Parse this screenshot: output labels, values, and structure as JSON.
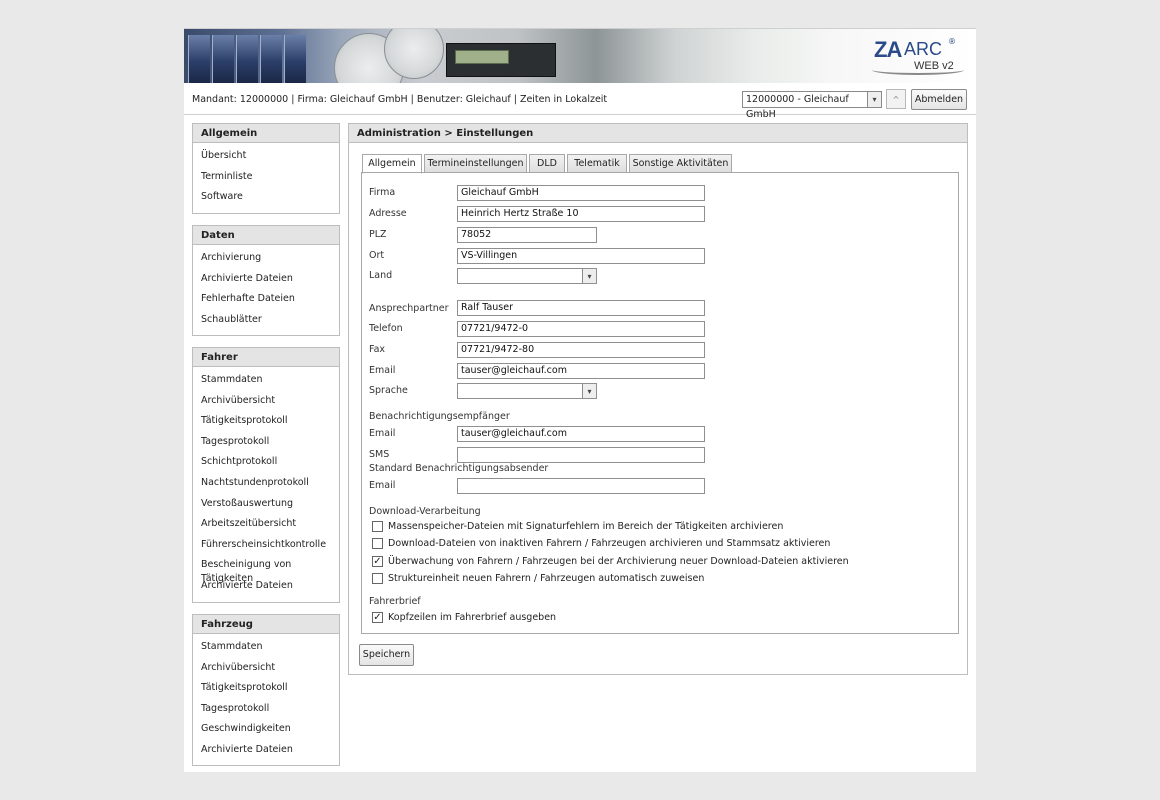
{
  "banner": {
    "logo_za": "ZA",
    "logo_arc": "ARC",
    "logo_reg": "®",
    "logo_web": "WEB v2"
  },
  "infobar": {
    "text": "Mandant: 12000000 | Firma: Gleichauf GmbH | Benutzer: Gleichauf | Zeiten in Lokalzeit",
    "mandant_selected": "12000000 - Gleichauf GmbH",
    "logout_label": "Abmelden"
  },
  "sidebar": {
    "allgemein": {
      "title": "Allgemein",
      "items": [
        "Übersicht",
        "Terminliste",
        "Software"
      ]
    },
    "daten": {
      "title": "Daten",
      "items": [
        "Archivierung",
        "Archivierte Dateien",
        "Fehlerhafte Dateien",
        "Schaublätter"
      ]
    },
    "fahrer": {
      "title": "Fahrer",
      "items": [
        "Stammdaten",
        "Archivübersicht",
        "Tätigkeitsprotokoll",
        "Tagesprotokoll",
        "Schichtprotokoll",
        "Nachtstundenprotokoll",
        "Verstoßauswertung",
        "Arbeitszeitübersicht",
        "Führerscheinsichtkontrolle",
        "Bescheinigung von Tätigkeiten",
        "Archivierte Dateien"
      ]
    },
    "fahrzeug": {
      "title": "Fahrzeug",
      "items": [
        "Stammdaten",
        "Archivübersicht",
        "Tätigkeitsprotokoll",
        "Tagesprotokoll",
        "Geschwindigkeiten",
        "Archivierte Dateien"
      ]
    }
  },
  "main": {
    "breadcrumb": "Administration > Einstellungen",
    "tabs": [
      "Allgemein",
      "Termineinstellungen",
      "DLD",
      "Telematik",
      "Sonstige Aktivitäten"
    ],
    "fields": {
      "firma": {
        "label": "Firma",
        "value": "Gleichauf GmbH"
      },
      "adresse": {
        "label": "Adresse",
        "value": "Heinrich Hertz Straße 10"
      },
      "plz": {
        "label": "PLZ",
        "value": "78052"
      },
      "ort": {
        "label": "Ort",
        "value": "VS-Villingen"
      },
      "land": {
        "label": "Land",
        "value": ""
      },
      "ansprechpartner": {
        "label": "Ansprechpartner",
        "value": "Ralf Tauser"
      },
      "telefon": {
        "label": "Telefon",
        "value": "07721/9472-0"
      },
      "fax": {
        "label": "Fax",
        "value": "07721/9472-80"
      },
      "email": {
        "label": "Email",
        "value": "tauser@gleichauf.com"
      },
      "sprache": {
        "label": "Sprache",
        "value": ""
      }
    },
    "notify_recipient": {
      "title": "Benachrichtigungsempfänger",
      "email_label": "Email",
      "email_value": "tauser@gleichauf.com",
      "sms_label": "SMS",
      "sms_value": ""
    },
    "notify_sender": {
      "title": "Standard Benachrichtigungsabsender",
      "email_label": "Email",
      "email_value": ""
    },
    "download": {
      "title": "Download-Verarbeitung",
      "options": [
        {
          "label": "Massenspeicher-Dateien mit Signaturfehlern im Bereich der Tätigkeiten archivieren",
          "checked": false
        },
        {
          "label": "Download-Dateien von inaktiven Fahrern / Fahrzeugen archivieren und Stammsatz aktivieren",
          "checked": false
        },
        {
          "label": "Überwachung von Fahrern / Fahrzeugen bei der Archivierung neuer Download-Dateien aktivieren",
          "checked": true
        },
        {
          "label": "Struktureinheit neuen Fahrern / Fahrzeugen automatisch zuweisen",
          "checked": false
        }
      ]
    },
    "fahrerbrief": {
      "title": "Fahrerbrief",
      "options": [
        {
          "label": "Kopfzeilen im Fahrerbrief ausgeben",
          "checked": true
        }
      ]
    },
    "save_label": "Speichern"
  },
  "icons": {
    "check": "✓",
    "chevron_down": "▾",
    "caret_up": "^"
  }
}
